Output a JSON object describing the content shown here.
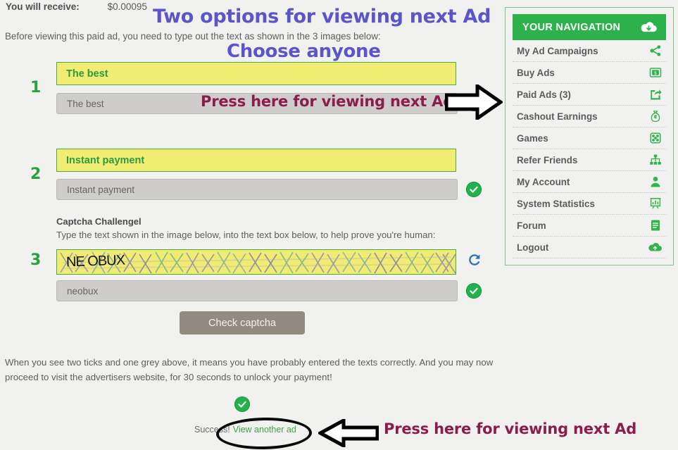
{
  "receive": {
    "label": "You will receive:",
    "amount": "$0.00095"
  },
  "intro": "Before viewing this paid ad, you need to type out the text as shown in the 3 images below:",
  "annotations": {
    "title_line1": "Two options for viewing next Ad",
    "title_line2": "Choose anyone",
    "press_top": "Press here for viewing next Ad",
    "press_bottom": "Press here for viewing next Ad",
    "purple_color": "#5a55c8",
    "maroon_color": "#8a1c4e"
  },
  "steps": [
    {
      "number": "1",
      "image_text": "The best",
      "input_value": "The best"
    },
    {
      "number": "2",
      "image_text": "Instant payment",
      "input_value": "Instant payment"
    },
    {
      "number": "3",
      "image_text": "NE OBUX",
      "input_value": "neobux"
    }
  ],
  "captcha": {
    "title": "Captcha Challengel",
    "subtitle": "Type the text shown in the image below, into the text box below, to help prove you're human:",
    "image_text": "NE OBUX",
    "input_value": "neobux",
    "refresh_icon": "refresh-icon",
    "check_button": "Check captcha"
  },
  "bottom_note": "When you see two ticks and one grey above, it means you have probably entered the texts correctly. And you may now proceed to visit the advertisers website, for 30 seconds to unlock your payment!",
  "success": {
    "text": "Success!",
    "link": "View another ad",
    "tick_icon": "green-check-icon"
  },
  "nav": {
    "header_title": "YOUR NAVIGATION",
    "header_icon": "cloud-download-icon",
    "header_bg": "#2db14a",
    "items": [
      {
        "label": "My Ad Campaigns",
        "icon": "share-nodes-icon"
      },
      {
        "label": "Buy Ads",
        "icon": "money-screen-icon"
      },
      {
        "label": "Paid Ads (3)",
        "icon": "share-arrow-icon"
      },
      {
        "label": "Cashout Earnings",
        "icon": "money-bag-icon"
      },
      {
        "label": "Games",
        "icon": "dice-icon"
      },
      {
        "label": "Refer Friends",
        "icon": "sitemap-icon"
      },
      {
        "label": "My Account",
        "icon": "user-icon"
      },
      {
        "label": "System Statistics",
        "icon": "presentation-chart-icon"
      },
      {
        "label": "Forum",
        "icon": "document-lines-icon"
      },
      {
        "label": "Logout",
        "icon": "cloud-upload-icon"
      }
    ]
  }
}
